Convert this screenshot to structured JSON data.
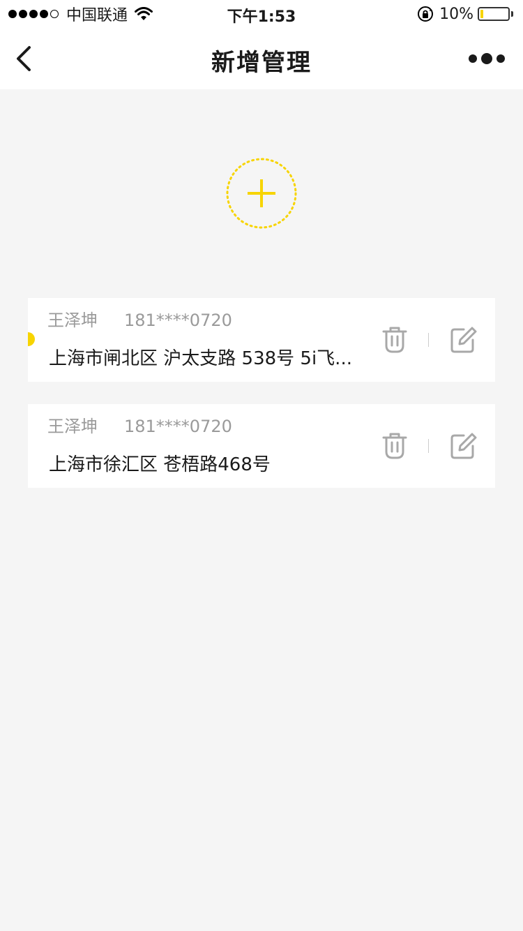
{
  "status_bar": {
    "carrier": "中国联通",
    "time": "下午1:53",
    "battery_percent": "10%",
    "battery_level": 0.1,
    "signal_bars_filled": 4,
    "signal_bars_total": 5
  },
  "nav": {
    "title": "新增管理",
    "back_icon": "chevron-left-icon",
    "more_icon": "more-dots-icon"
  },
  "add_button": {
    "icon": "plus-icon",
    "accent_color": "#f7d400"
  },
  "addresses": [
    {
      "name": "王泽坤",
      "phone": "181****0720",
      "address": "上海市闸北区 沪太支路 538号 5i飞...",
      "is_default": true
    },
    {
      "name": "王泽坤",
      "phone": "181****0720",
      "address": "上海市徐汇区 苍梧路468号",
      "is_default": false
    }
  ],
  "colors": {
    "accent": "#f7d400",
    "background": "#f5f5f5",
    "secondary_text": "#9a9a9a",
    "icon_gray": "#a8a8a8"
  }
}
